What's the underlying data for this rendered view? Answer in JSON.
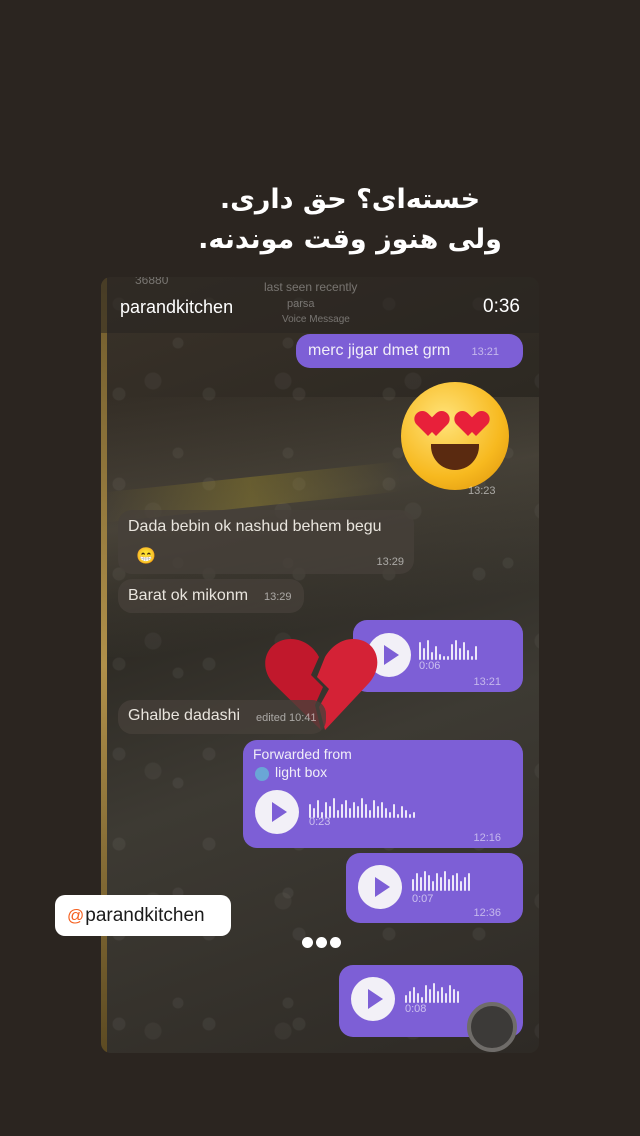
{
  "story": {
    "caption_line1": "خسته‌ای؟ حق داری.",
    "caption_line2": "ولی هنوز وقت موندنه.",
    "dots": "•••"
  },
  "video": {
    "handle": "parandkitchen",
    "timer": "0:36"
  },
  "chat_header": {
    "back_count": "36880",
    "status": "last seen recently",
    "contact": "parsa",
    "sub": "Voice Message"
  },
  "messages": [
    {
      "type": "out_text",
      "text": "merc jigar dmet grm",
      "time": "13:21"
    },
    {
      "type": "sticker",
      "emoji": "heart-eyes",
      "time": "13:23"
    },
    {
      "type": "in_text",
      "text": "Dada bebin ok nashud behem begu",
      "extra": "😁",
      "time": "13:29"
    },
    {
      "type": "in_text",
      "text": "Barat ok mikonm",
      "time": "13:29"
    },
    {
      "type": "out_voice",
      "duration": "0:06",
      "time": "13:21"
    },
    {
      "type": "in_text",
      "text": "Ghalbe dadashi",
      "time": "edited 10:41"
    },
    {
      "type": "forwarded_voice",
      "forwarded_label": "Forwarded from",
      "source": "light box",
      "duration": "0:23",
      "time": "12:16"
    },
    {
      "type": "out_voice",
      "duration": "0:07",
      "time": "12:36"
    },
    {
      "type": "out_voice",
      "duration": "0:08",
      "time": ""
    }
  ],
  "tag": {
    "icon": "threads-icon",
    "label": "parandkitchen"
  },
  "colors": {
    "background": "#2b2520",
    "outgoing_bubble": "#7d5fd6",
    "incoming_bubble": "#46403a",
    "tag_bg": "#ffffff"
  }
}
